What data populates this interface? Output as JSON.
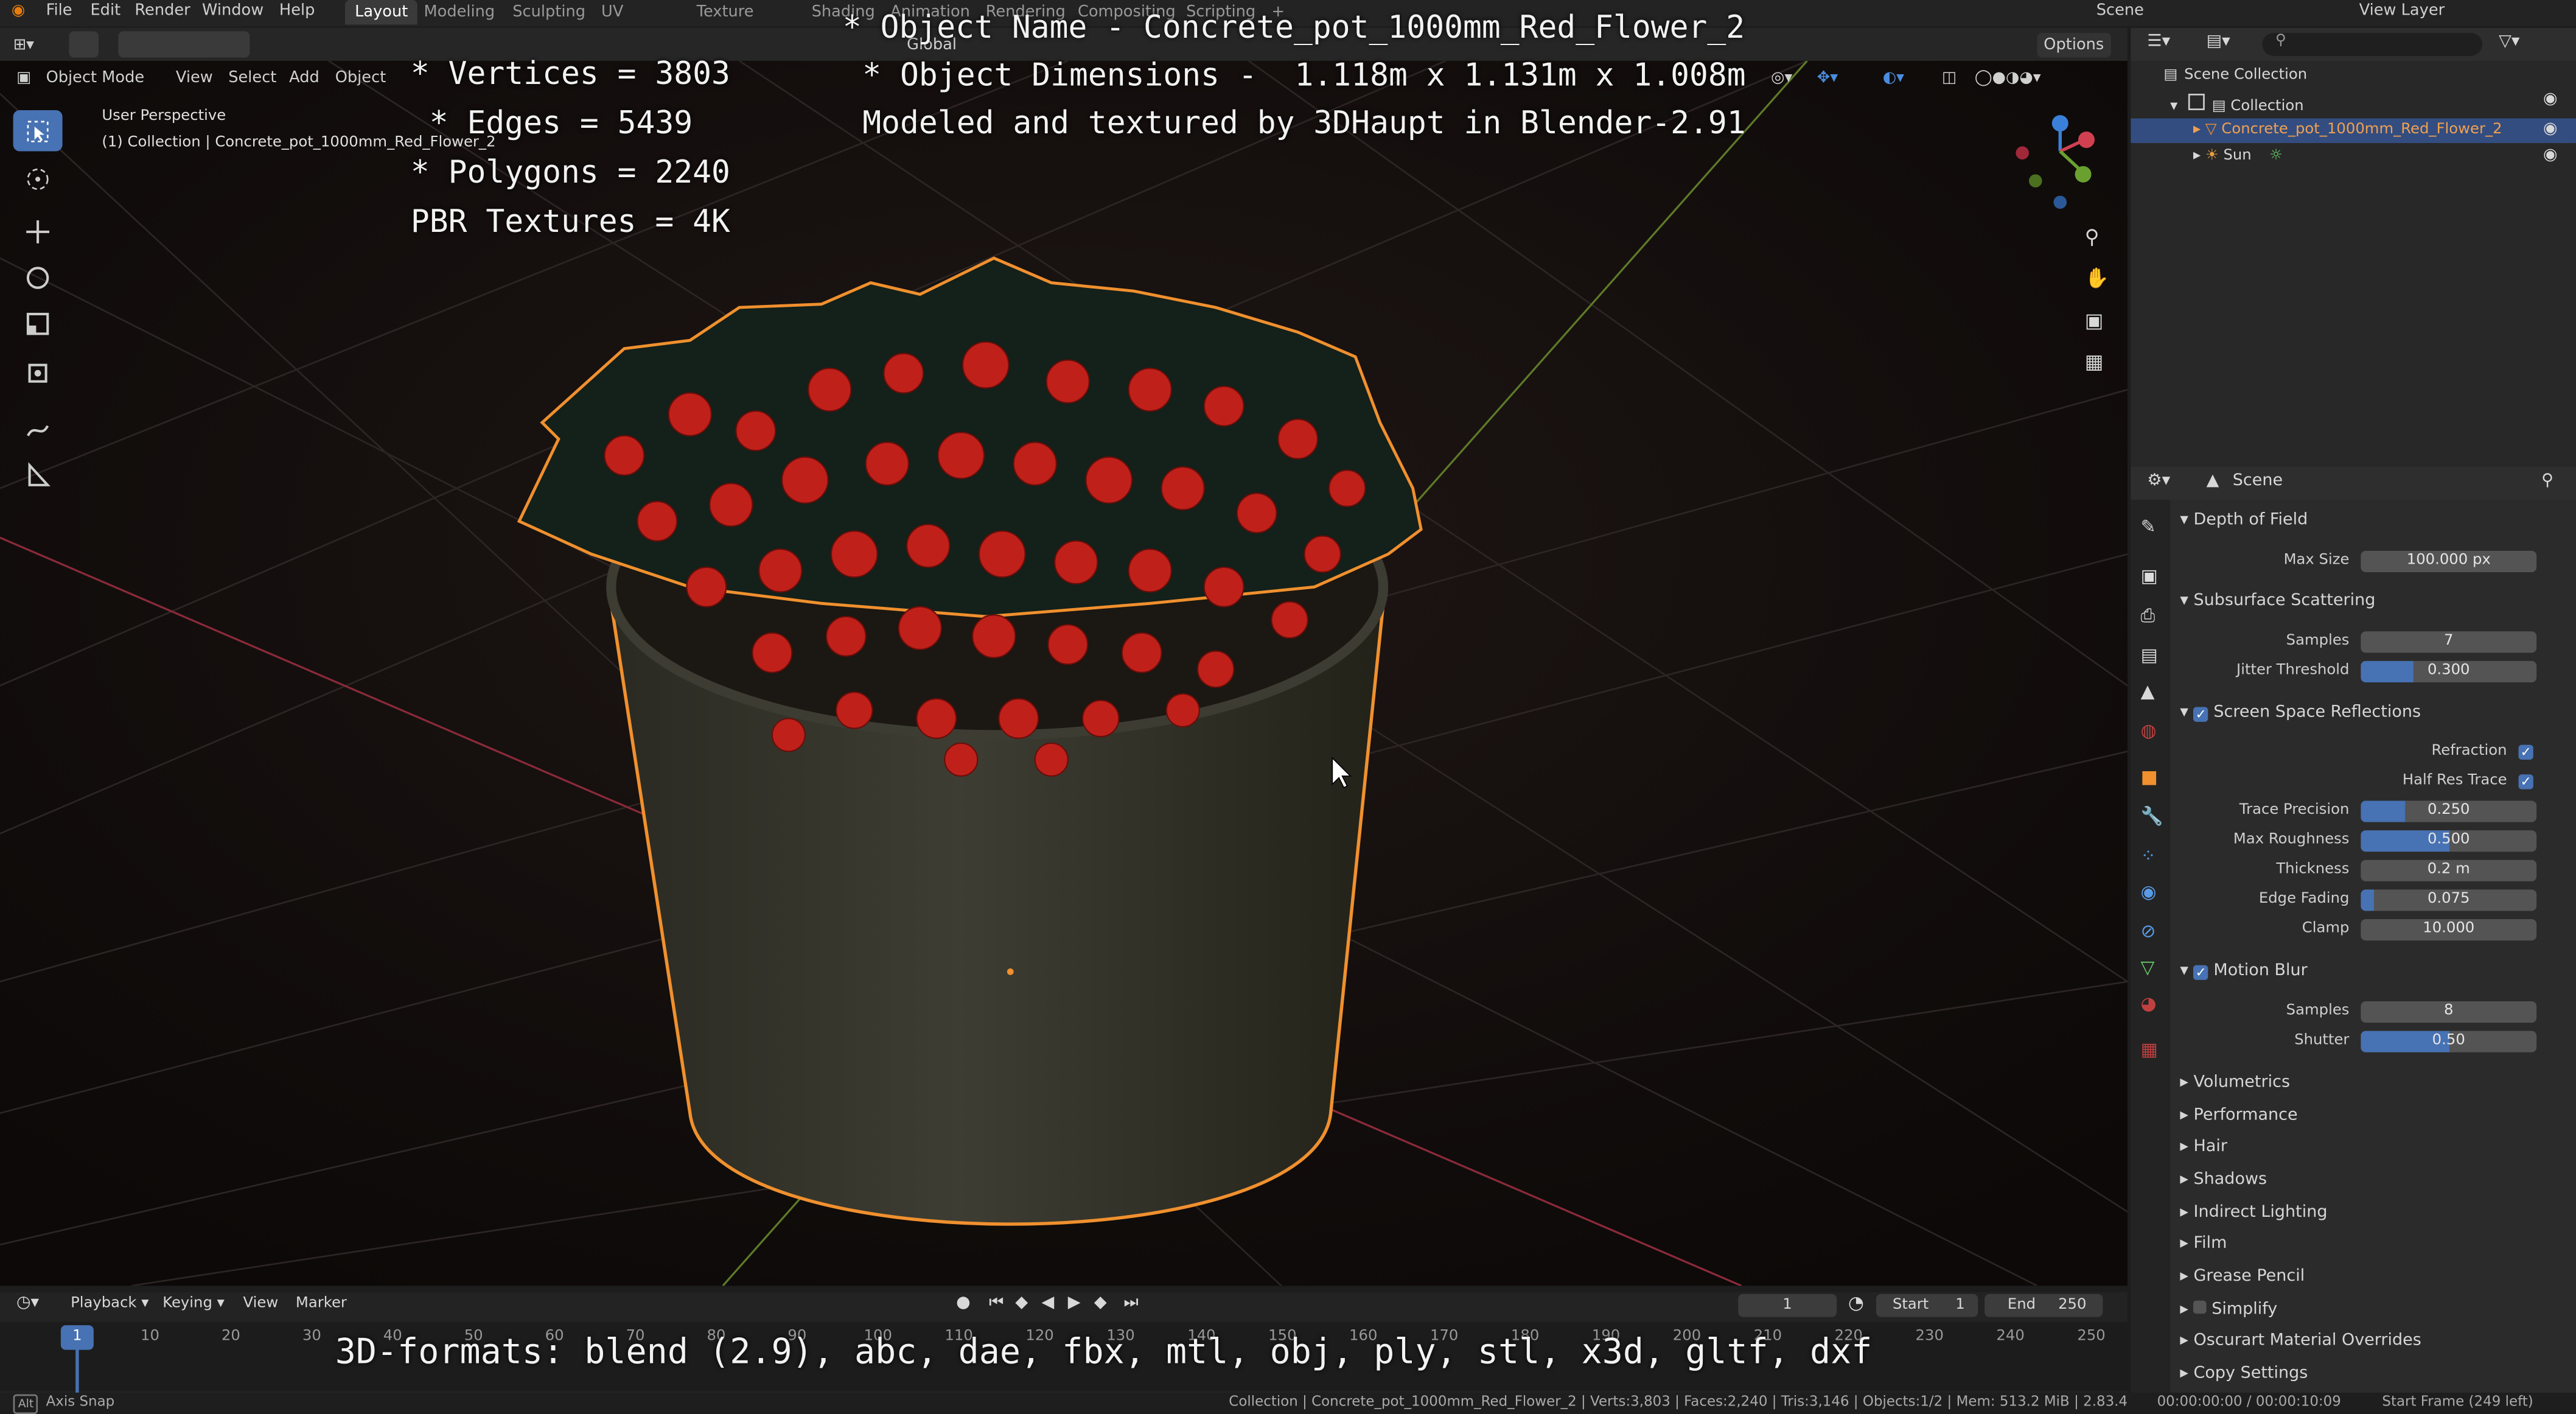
{
  "menu": [
    "File",
    "Edit",
    "Render",
    "Window",
    "Help"
  ],
  "workspaces": {
    "active": "Layout",
    "tabs": [
      "Layout",
      "Modeling",
      "Sculpting",
      "UV Editing",
      "Texture Paint",
      "Shading",
      "Animation",
      "Rendering",
      "Compositing",
      "Scripting"
    ]
  },
  "top_right": {
    "scene": "Scene",
    "view_layer": "View Layer"
  },
  "viewport_header": {
    "mode": "Object Mode",
    "menus": [
      "View",
      "Select",
      "Add",
      "Object"
    ],
    "transform_orientation": "Global",
    "options": "Options"
  },
  "viewport": {
    "perspective": "User Perspective",
    "collection_label": "(1) Collection | Concrete_pot_1000mm_Red_Flower_2",
    "overlay_lines_left": [
      "* Vertices = 3803",
      " * Edges = 5439",
      "* Polygons = 2240",
      "PBR Textures = 4K"
    ],
    "overlay_lines_right": [
      "* Object Name - Concrete_pot_1000mm_Red_Flower_2",
      "* Object Dimensions -  1.118m x 1.131m x 1.008m",
      "Modeled and textured by 3DHaupt in Blender-2.91"
    ],
    "formats": "3D-formats: blend (2.9), abc, dae, fbx, mtl, obj, ply, stl, x3d, gltf, dxf"
  },
  "outliner": {
    "root": "Scene Collection",
    "collection": "Collection",
    "items": [
      "Concrete_pot_1000mm_Red_Flower_2",
      "Sun"
    ]
  },
  "properties": {
    "context": "Scene",
    "sections": {
      "dof": {
        "title": "Depth of Field",
        "max_size_label": "Max Size",
        "max_size": "100.000 px"
      },
      "sss": {
        "title": "Subsurface Scattering",
        "samples_label": "Samples",
        "samples": "7",
        "jitter_label": "Jitter Threshold",
        "jitter": "0.300",
        "jitter_frac": 0.3
      },
      "ssr": {
        "title": "Screen Space Reflections",
        "refraction_label": "Refraction",
        "half_res_label": "Half Res Trace",
        "trace_precision_label": "Trace Precision",
        "trace_precision": "0.250",
        "trace_precision_frac": 0.25,
        "max_roughness_label": "Max Roughness",
        "max_roughness": "0.500",
        "max_roughness_frac": 0.5,
        "thickness_label": "Thickness",
        "thickness": "0.2 m",
        "edge_fading_label": "Edge Fading",
        "edge_fading": "0.075",
        "edge_fading_frac": 0.075,
        "clamp_label": "Clamp",
        "clamp": "10.000"
      },
      "motion_blur": {
        "title": "Motion Blur",
        "samples_label": "Samples",
        "samples": "8",
        "shutter_label": "Shutter",
        "shutter": "0.50",
        "shutter_frac": 0.5
      },
      "collapsed": [
        "Volumetrics",
        "Performance",
        "Hair",
        "Shadows",
        "Indirect Lighting",
        "Film",
        "Grease Pencil",
        "Simplify",
        "Oscurart Material Overrides",
        "Copy Settings"
      ]
    }
  },
  "timeline": {
    "menus": [
      "Playback",
      "Keying",
      "View",
      "Marker"
    ],
    "current_frame": "1",
    "start_label": "Start",
    "start": "1",
    "end_label": "End",
    "end": "250",
    "ticks": [
      "1",
      "10",
      "20",
      "30",
      "40",
      "50",
      "60",
      "70",
      "80",
      "90",
      "100",
      "110",
      "120",
      "130",
      "140",
      "150",
      "160",
      "170",
      "180",
      "190",
      "200",
      "210",
      "220",
      "230",
      "240",
      "250"
    ]
  },
  "statusbar": {
    "left": "Axis Snap",
    "center": "Collection | Concrete_pot_1000mm_Red_Flower_2 | Verts:3,803 | Faces:2,240 | Tris:3,146 | Objects:1/2 | Mem: 513.2 MiB | 2.83.4",
    "time": "00:00:00:00 / 00:00:10:09",
    "frame_info": "Start Frame (249 left)"
  },
  "colors": {
    "accent": "#4772b3",
    "selection": "#f0902e",
    "flower_red": "#c0201a"
  }
}
